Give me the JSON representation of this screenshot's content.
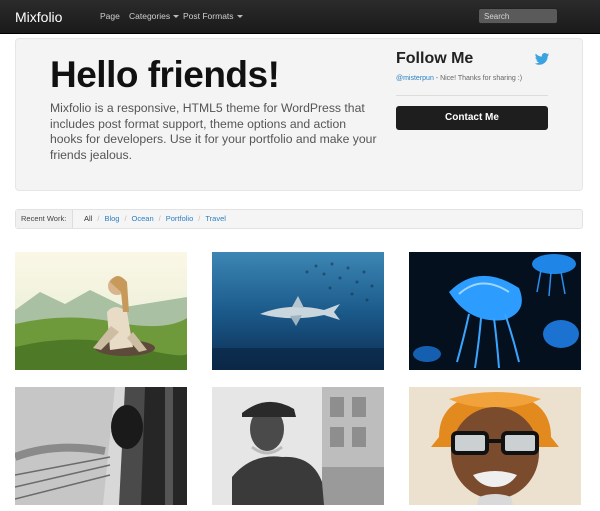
{
  "navbar": {
    "brand": "Mixfolio",
    "items": [
      {
        "label": "Page",
        "has_caret": false
      },
      {
        "label": "Categories",
        "has_caret": true
      },
      {
        "label": "Post Formats",
        "has_caret": true
      }
    ],
    "search_placeholder": "Search"
  },
  "hero": {
    "title": "Hello friends!",
    "text": "Mixfolio is a responsive, HTML5 theme for WordPress that includes post format support, theme options and action hooks for developers. Use it for your portfolio and make your friends jealous."
  },
  "follow": {
    "title": "Follow Me",
    "icon": "twitter-bird-icon",
    "tweet_user": "@misterpun",
    "tweet_text": " - Nice! Thanks for sharing :)",
    "contact_label": "Contact Me"
  },
  "filter": {
    "label": "Recent Work:",
    "items": [
      "All",
      "Blog",
      "Ocean",
      "Portfolio",
      "Travel"
    ],
    "active": "All"
  },
  "colors": {
    "navbar_bg": "#1f1f1f",
    "hero_bg": "#f4f4f4",
    "link": "#2a7fc4",
    "button_bg": "#1e1e1e"
  },
  "gallery": [
    {
      "subject": "woman sitting on grassy hill"
    },
    {
      "subject": "shark in deep blue water"
    },
    {
      "subject": "glowing blue jellyfish"
    },
    {
      "subject": "black and white train window"
    },
    {
      "subject": "black and white man in flat cap"
    },
    {
      "subject": "old man with glasses and orange turban"
    }
  ]
}
